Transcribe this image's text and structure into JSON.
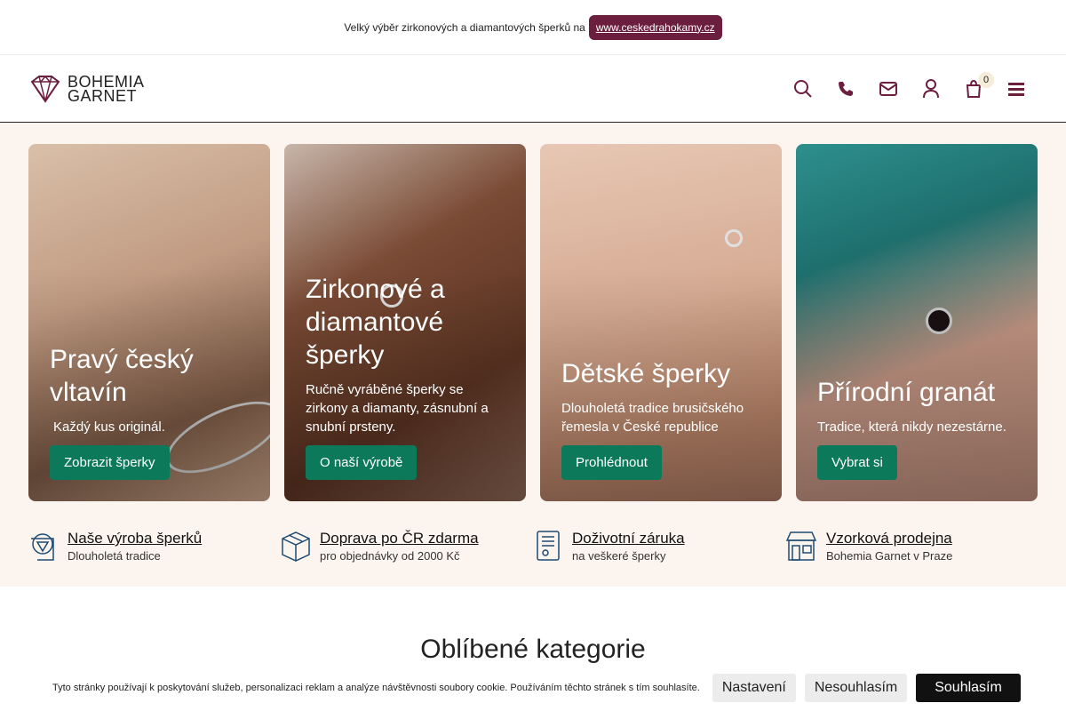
{
  "topbar": {
    "text": "Velký výběr zirkonových a diamantových šperků na",
    "link": "www.ceskedrahokamy.cz"
  },
  "header": {
    "logo_line1": "BOHEMIA",
    "logo_line2": "GARNET",
    "cart_count": "0",
    "icons": [
      "search-icon",
      "phone-icon",
      "mail-icon",
      "user-icon",
      "cart-icon",
      "menu-icon"
    ]
  },
  "cards": [
    {
      "title": "Pravý český vltavín",
      "text": "Každý kus originál.",
      "button": "Zobrazit šperky"
    },
    {
      "title": "Zirkonové a diamantové šperky",
      "text": "Ručně vyráběné šperky se zirkony a diamanty, zásnubní a snubní prsteny.",
      "button": "O naší výrobě"
    },
    {
      "title": "Dětské šperky",
      "text": "Dlouholetá tradice brusičského řemesla v České republice",
      "button": "Prohlédnout"
    },
    {
      "title": "Přírodní granát",
      "text": "Tradice, která nikdy nezestárne.",
      "button": "Vybrat si"
    }
  ],
  "features": [
    {
      "title": "Naše výroba šperků",
      "sub": "Dlouholetá tradice",
      "icon": "production-icon"
    },
    {
      "title": "Doprava po ČR zdarma",
      "sub": "pro objednávky od 2000 Kč",
      "icon": "box-icon"
    },
    {
      "title": "Doživotní záruka",
      "sub": "na veškeré šperky",
      "icon": "certificate-icon"
    },
    {
      "title": "Vzorková prodejna",
      "sub": "Bohemia Garnet v Praze",
      "icon": "store-icon"
    }
  ],
  "section_title": "Oblíbené kategorie",
  "cookie": {
    "text": "Tyto stránky používají k poskytování služeb, personalizaci reklam a analýze návštěvnosti soubory cookie. Používáním těchto stránek s tím souhlasíte.",
    "settings": "Nastavení",
    "decline": "Nesouhlasím",
    "accept": "Souhlasím"
  },
  "colors": {
    "accent": "#0c7a5a",
    "brand": "#6b1e3e",
    "band": "#fcf5ef"
  }
}
